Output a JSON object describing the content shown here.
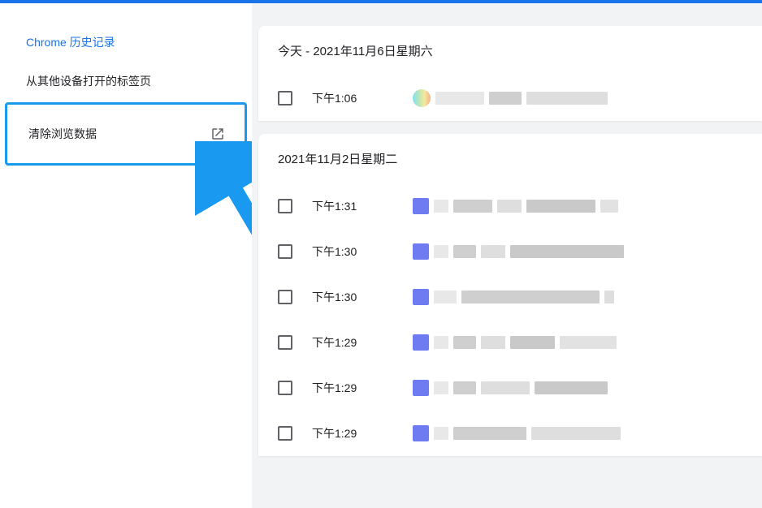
{
  "sidebar": {
    "items": [
      {
        "label": "Chrome 历史记录",
        "active": true
      },
      {
        "label": "从其他设备打开的标签页",
        "active": false
      }
    ],
    "clear_label": "清除浏览数据"
  },
  "sections": [
    {
      "header": "今天 - 2021年11月6日星期六",
      "rows": [
        {
          "time": "下午1:06",
          "favicon_gradient": "linear-gradient(90deg,#7fe0f5,#b6e6bb,#f5e99a,#f5b08d)",
          "blurs": [
            60,
            40,
            100
          ]
        }
      ]
    },
    {
      "header": "2021年11月2日星期二",
      "rows": [
        {
          "time": "下午1:31",
          "favicon": "#6f7bf0",
          "blurs": [
            18,
            48,
            30,
            85,
            22
          ]
        },
        {
          "time": "下午1:30",
          "favicon": "#6f7bf0",
          "blurs": [
            18,
            28,
            30,
            140
          ]
        },
        {
          "time": "下午1:30",
          "favicon": "#6f7bf0",
          "blurs": [
            28,
            170,
            12
          ]
        },
        {
          "time": "下午1:29",
          "favicon": "#6f7bf0",
          "blurs": [
            18,
            28,
            30,
            55,
            70
          ]
        },
        {
          "time": "下午1:29",
          "favicon": "#6f7bf0",
          "blurs": [
            18,
            28,
            60,
            90
          ]
        },
        {
          "time": "下午1:29",
          "favicon": "#6f7bf0",
          "blurs": [
            18,
            90,
            110
          ]
        }
      ]
    }
  ]
}
